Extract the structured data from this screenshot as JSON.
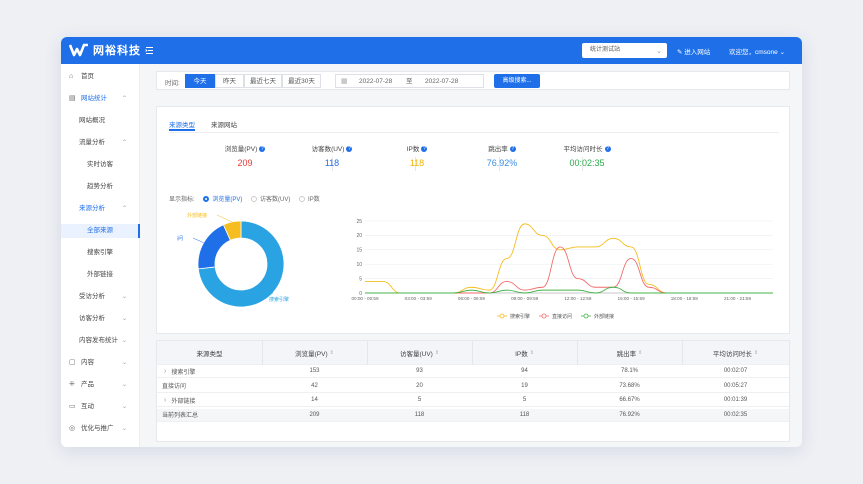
{
  "app": {
    "brand": "网裕科技"
  },
  "topbar": {
    "site_select": "统计测试站",
    "enter_site": "进入网站",
    "welcome": "欢迎您，cmsone"
  },
  "sidebar": {
    "items": [
      {
        "label": "首页",
        "icon": "home-icon"
      },
      {
        "label": "网站统计",
        "icon": "chart-icon"
      },
      {
        "label": "网站概况"
      },
      {
        "label": "流量分析"
      },
      {
        "label": "实时访客"
      },
      {
        "label": "趋势分析"
      },
      {
        "label": "来源分析"
      },
      {
        "label": "全部来源"
      },
      {
        "label": "搜索引擎"
      },
      {
        "label": "外部链接"
      },
      {
        "label": "受访分析"
      },
      {
        "label": "访客分析"
      },
      {
        "label": "内容发布统计"
      },
      {
        "label": "内容",
        "icon": "doc-icon"
      },
      {
        "label": "产品",
        "icon": "grid-icon"
      },
      {
        "label": "互动",
        "icon": "chat-icon"
      },
      {
        "label": "优化与推广",
        "icon": "promo-icon"
      }
    ]
  },
  "filter": {
    "time_label": "时间:",
    "buttons": [
      "今天",
      "昨天",
      "最近七天",
      "最近30天"
    ],
    "date_from": "2022-07-28",
    "date_sep": "至",
    "date_to": "2022-07-28",
    "advanced": "高级搜索..."
  },
  "tabs": [
    "来源类型",
    "来源网站"
  ],
  "metrics": [
    {
      "label": "浏览量(PV)",
      "value": "209",
      "color": "#e53935"
    },
    {
      "label": "访客数(UV)",
      "value": "118",
      "color": "#1f6fe8"
    },
    {
      "label": "IP数",
      "value": "118",
      "color": "#f0b400"
    },
    {
      "label": "跳出率",
      "value": "76.92%",
      "color": "#3a8ee6"
    },
    {
      "label": "平均访问时长",
      "value": "00:02:35",
      "color": "#2eaa4a"
    }
  ],
  "indicator": {
    "label": "显示指标:",
    "options": [
      "浏览量(PV)",
      "访客数(UV)",
      "IP数"
    ],
    "selected": 0
  },
  "donut_data": {
    "slices": [
      {
        "name": "搜索引擎",
        "value": 153,
        "color": "#2aa3e3"
      },
      {
        "name": "直接访问",
        "value": 42,
        "color": "#1f6fe8"
      },
      {
        "name": "外部链接",
        "value": 14,
        "color": "#f5bd1f"
      }
    ]
  },
  "chart_data": {
    "type": "line",
    "x": [
      "00:00 - 00:59",
      "01:00 - 01:59",
      "02:00 - 02:59",
      "03:00 - 03:59",
      "04:00 - 04:59",
      "05:00 - 05:59",
      "06:00 - 06:59",
      "07:00 - 07:59",
      "08:00 - 08:59",
      "09:00 - 09:59",
      "10:00 - 10:59",
      "11:00 - 11:59",
      "12:00 - 12:59",
      "13:00 - 13:59",
      "14:00 - 14:59",
      "15:00 - 15:59",
      "16:00 - 16:59",
      "17:00 - 17:59",
      "18:00 - 18:59",
      "19:00 - 19:59",
      "20:00 - 20:59",
      "21:00 - 21:59",
      "22:00 - 22:59",
      "23:00 - 23:59"
    ],
    "xticks": [
      "00:00 - 00:59",
      "03:00 - 03:59",
      "06:00 - 06:59",
      "09:00 - 09:59",
      "12:00 - 12:59",
      "15:00 - 15:59",
      "18:00 - 18:59",
      "21:00 - 21:59"
    ],
    "series": [
      {
        "name": "搜索引擎",
        "color": "#f5bd1f",
        "values": [
          4,
          4,
          0,
          0,
          0,
          0,
          2,
          1,
          12,
          24,
          20,
          15,
          16,
          16,
          19,
          16,
          3,
          0,
          0,
          0,
          0,
          0,
          0,
          0
        ]
      },
      {
        "name": "直接访问",
        "color": "#f26b6b",
        "values": [
          0,
          0,
          0,
          0,
          0,
          0,
          0,
          0,
          4,
          1,
          2,
          16,
          5,
          2,
          2,
          12,
          2,
          0,
          0,
          0,
          0,
          0,
          0,
          0
        ]
      },
      {
        "name": "外部链接",
        "color": "#44b549",
        "values": [
          0,
          0,
          0,
          0,
          0,
          0,
          1,
          0,
          1,
          0,
          1,
          1,
          1,
          0,
          2,
          0,
          0,
          0,
          0,
          0,
          0,
          0,
          0,
          0
        ]
      }
    ],
    "ylim": [
      0,
      25
    ],
    "yticks": [
      0,
      5,
      10,
      15,
      20,
      25
    ],
    "legend": "bottom"
  },
  "table": {
    "headers": [
      "来源类型",
      "浏览量(PV)",
      "访客量(UV)",
      "IP数",
      "跳出率",
      "平均访问时长"
    ],
    "rows": [
      [
        "搜索引擎",
        "153",
        "93",
        "94",
        "78.1%",
        "00:02:07"
      ],
      [
        "直接访问",
        "42",
        "20",
        "19",
        "73.68%",
        "00:05:27"
      ],
      [
        "外部链接",
        "14",
        "5",
        "5",
        "66.67%",
        "00:01:39"
      ],
      [
        "当前列表汇总",
        "209",
        "118",
        "118",
        "76.92%",
        "00:02:35"
      ]
    ]
  }
}
